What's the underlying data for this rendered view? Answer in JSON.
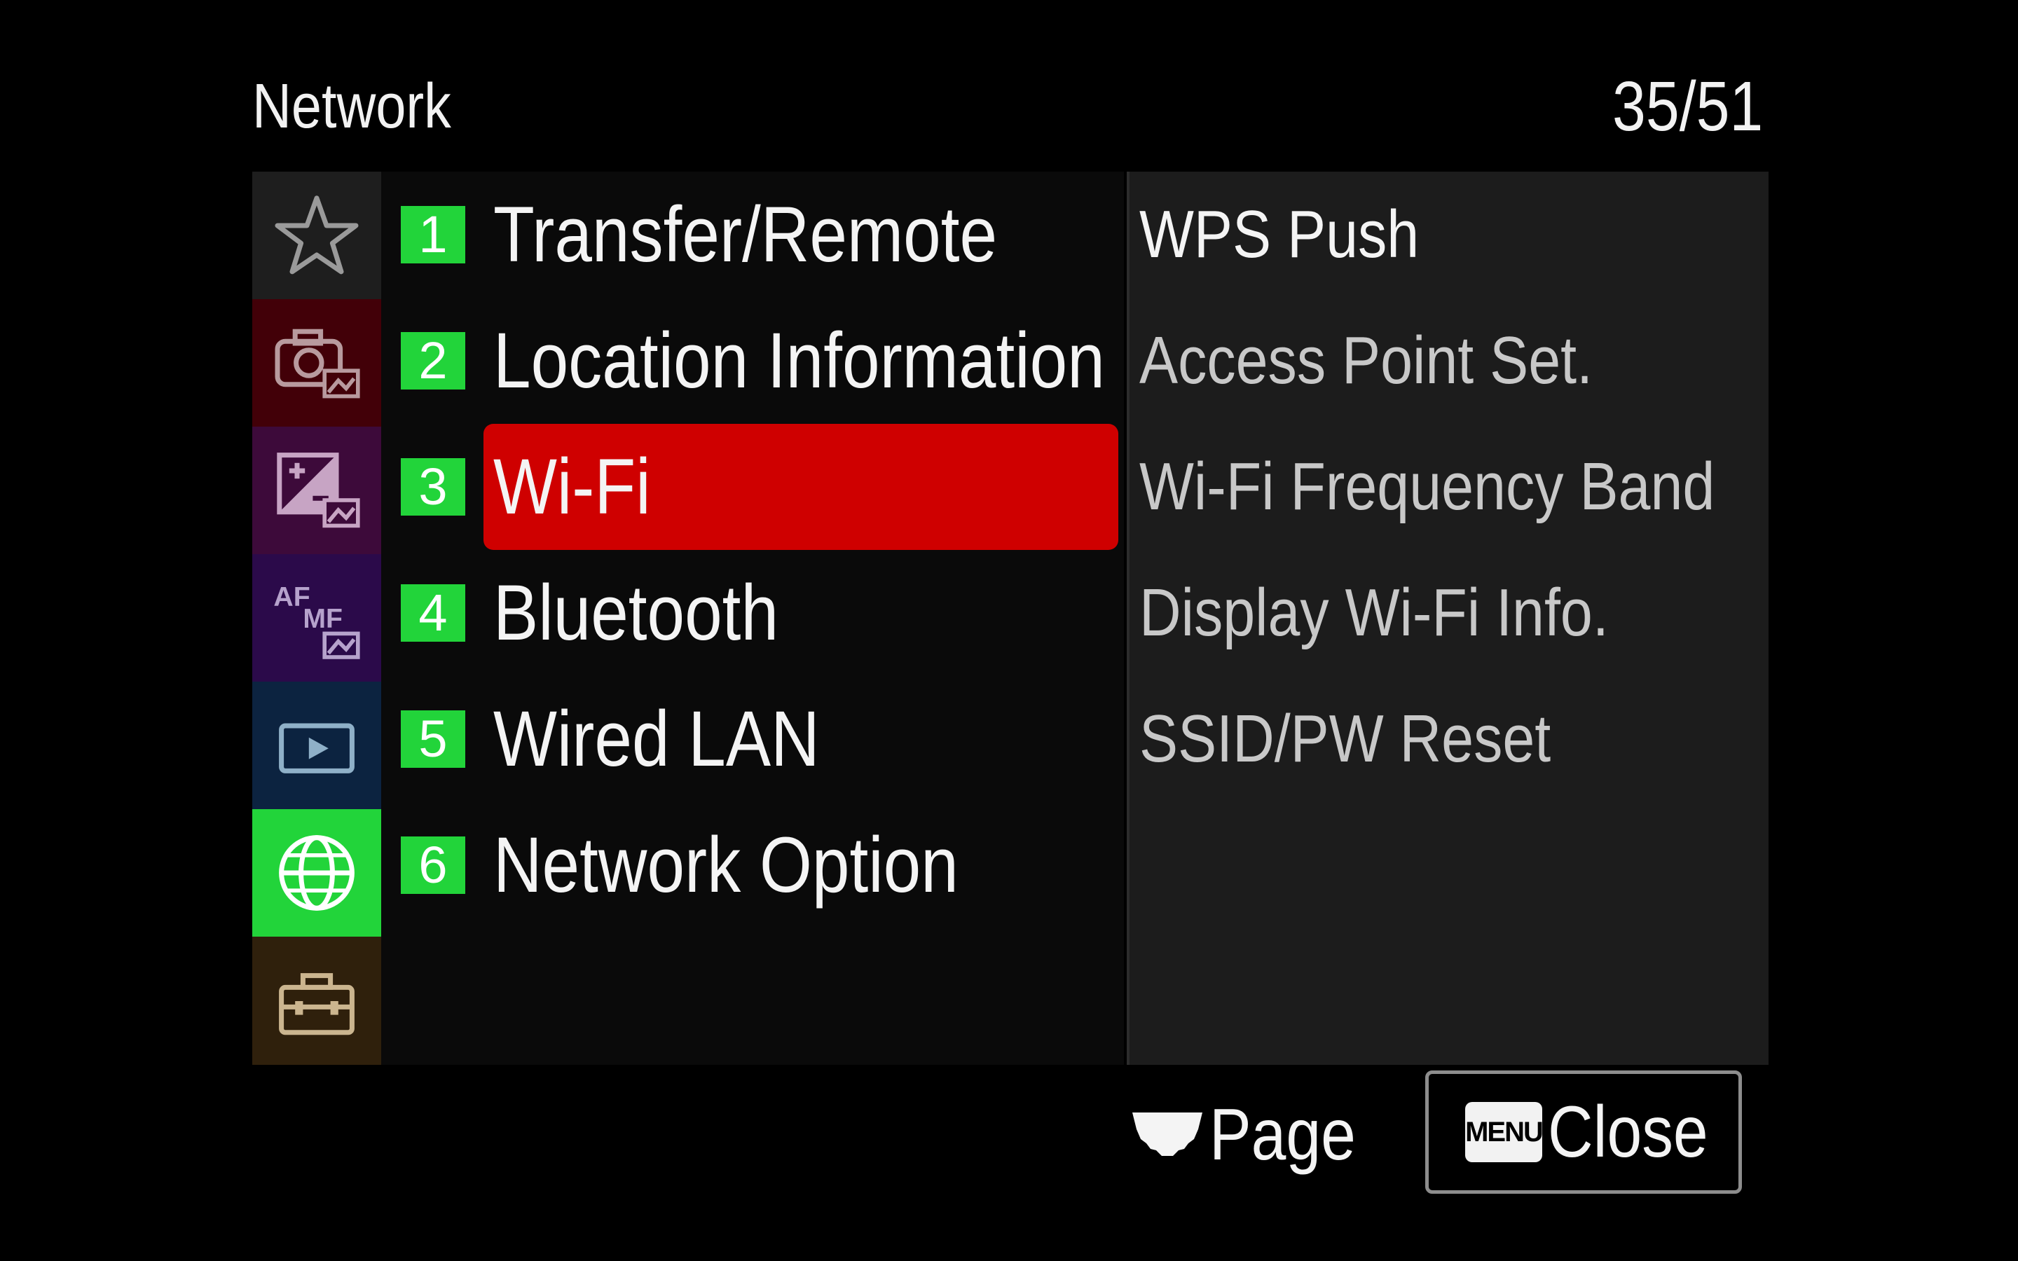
{
  "header": {
    "title": "Network",
    "page_counter": "35/51"
  },
  "sidebar": {
    "categories": [
      {
        "icon": "star-icon",
        "bg": "#1e1e1e",
        "selected": false
      },
      {
        "icon": "camera-image-icon",
        "bg": "#420008",
        "selected": false
      },
      {
        "icon": "exposure-image-icon",
        "bg": "#3d0a3a",
        "selected": false
      },
      {
        "icon": "af-mf-icon",
        "bg": "#2b0a4a",
        "selected": false
      },
      {
        "icon": "playback-icon",
        "bg": "#0c2340",
        "selected": false
      },
      {
        "icon": "globe-icon",
        "bg": "#22d43a",
        "selected": true
      },
      {
        "icon": "toolbox-icon",
        "bg": "#2f200c",
        "selected": false
      }
    ],
    "af_label": "AF",
    "mf_label": "MF"
  },
  "menu": {
    "items": [
      {
        "number": "1",
        "label": "Transfer/Remote"
      },
      {
        "number": "2",
        "label": "Location Information"
      },
      {
        "number": "3",
        "label": "Wi-Fi"
      },
      {
        "number": "4",
        "label": "Bluetooth"
      },
      {
        "number": "5",
        "label": "Wired LAN"
      },
      {
        "number": "6",
        "label": "Network Option"
      }
    ],
    "selected_index": 2
  },
  "submenu": {
    "items": [
      "WPS Push",
      "Access Point Set.",
      "Wi-Fi Frequency Band",
      "Display Wi-Fi Info.",
      "SSID/PW Reset"
    ]
  },
  "footer": {
    "page_label": "Page",
    "page_icon": "dial-icon",
    "menu_key": "MENU",
    "close_label": "Close"
  },
  "colors": {
    "accent_green": "#22d43a",
    "selection_red": "#cf0000",
    "panel_bg": "#1c1c1c"
  }
}
